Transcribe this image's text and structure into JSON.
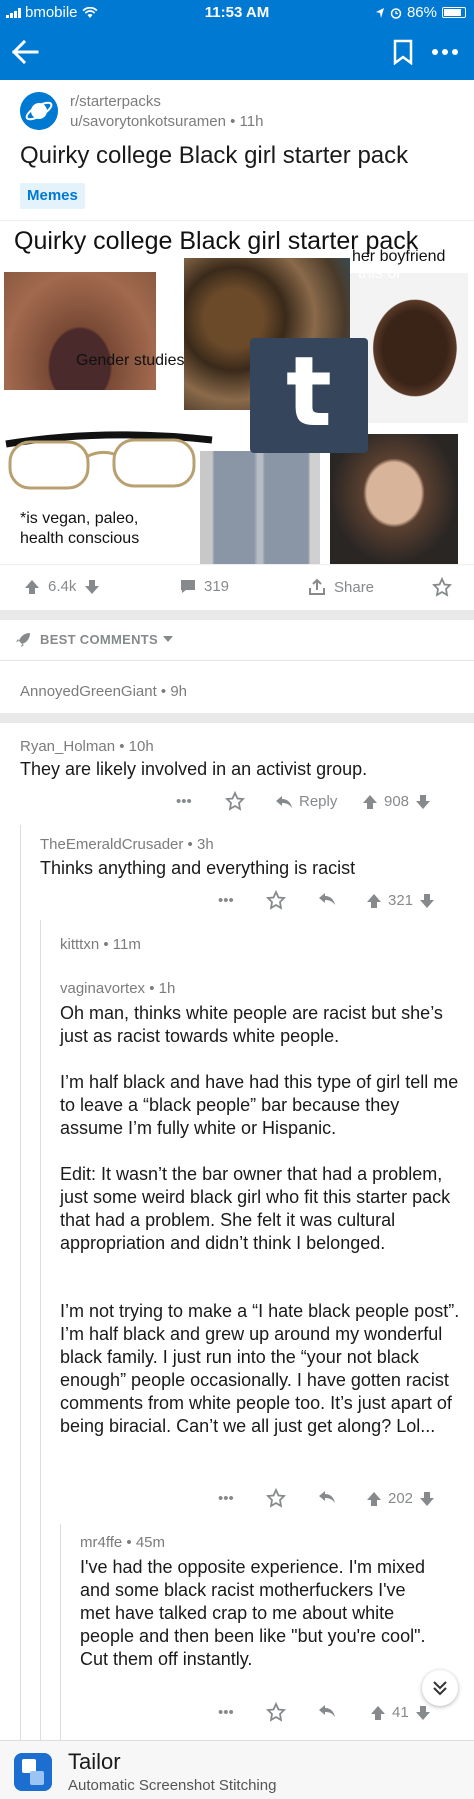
{
  "status_bar": {
    "carrier": "bmobile",
    "time": "11:53 AM",
    "battery": "86%",
    "battery_level": 0.86
  },
  "post": {
    "subreddit": "r/starterpacks",
    "user_line": "u/savorytonkotsuramen • 11h",
    "title": "Quirky college Black girl starter pack",
    "flair": "Memes",
    "image": {
      "title": "Quirky college Black girl starter pack",
      "caption_boyfriend_1": "her boyfriend",
      "caption_boyfriend_2": "this or",
      "caption_gender": "Gender studies",
      "caption_vegan_1": "*is vegan, paleo,",
      "caption_vegan_2": "health conscious",
      "tumblr_letter": "t"
    },
    "votes": "6.4k",
    "comments_count": "319",
    "share_label": "Share"
  },
  "sort": {
    "label": "BEST COMMENTS"
  },
  "comments": [
    {
      "author": "AnnoyedGreenGiant • 9h"
    },
    {
      "author": "Ryan_Holman • 10h",
      "body": "They are likely involved in an activist group.",
      "reply_label": "Reply",
      "score": "908"
    },
    {
      "author": "TheEmeraldCrusader • 3h",
      "body": "Thinks anything and everything is racist",
      "score": "321"
    },
    {
      "author": "kitttxn • 11m"
    },
    {
      "author": "vaginavortex • 1h",
      "p1": "Oh man, thinks white people are racist but she’s just as racist towards white people.",
      "p2": "I’m half black and have had this type of girl tell me to leave a “black people” bar because they assume I’m fully white or Hispanic.",
      "p3": "Edit: It wasn’t the bar owner that had a problem, just some weird black girl who fit this starter pack that had a problem. She felt it was cultural appropriation and didn’t think I belonged.",
      "p4": "I’m not trying to make a “I hate black people post”. I’m half black and grew up around my wonderful black family. I just run into the “your not black enough” people occasionally. I have gotten racist comments from white people too. It’s just apart of being biracial. Can’t we all just get along? Lol...",
      "score": "202"
    },
    {
      "author": "mr4ffe • 45m",
      "body": "I've had the opposite experience. I'm mixed and some black racist motherfuckers I've met have talked crap to me about white people and then been like \"but you're cool\". Cut them off instantly.",
      "score": "41"
    }
  ],
  "footer": {
    "app_name": "Tailor",
    "tagline": "Automatic Screenshot Stitching"
  },
  "colors": {
    "accent": "#0079d3",
    "muted": "#878a8c",
    "text": "#1a1a1b"
  }
}
